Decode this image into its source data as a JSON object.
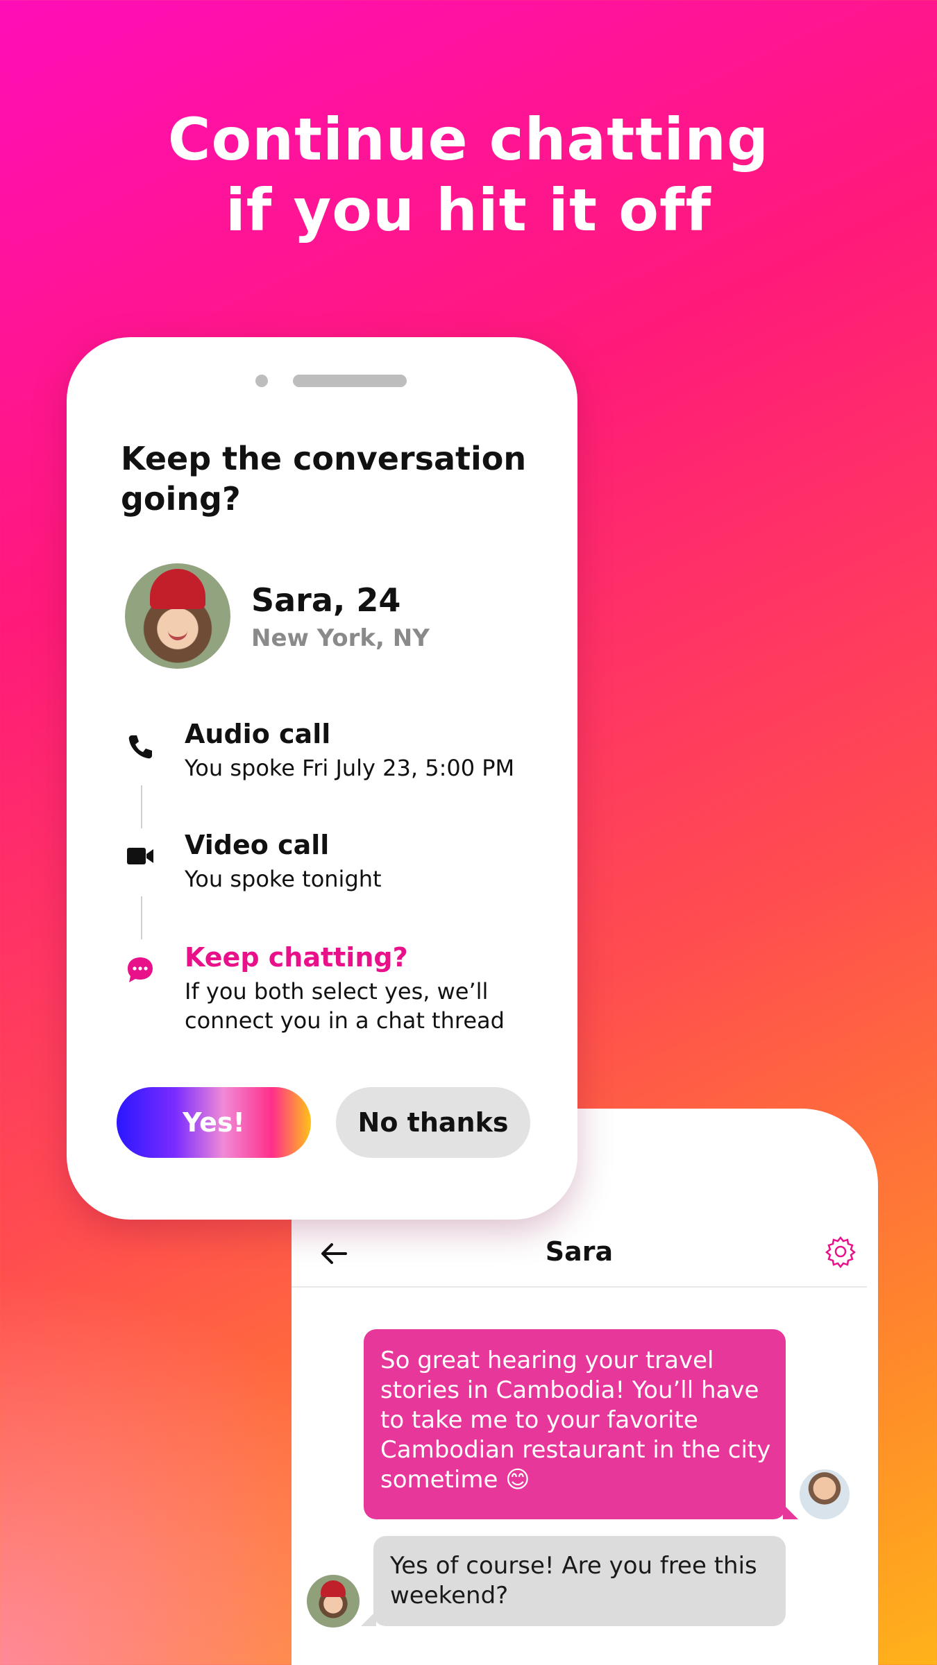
{
  "headline": "Continue chatting\nif you hit it off",
  "modal": {
    "title": "Keep the conversation\ngoing?",
    "profile": {
      "name": "Sara, 24",
      "location": "New York, NY"
    },
    "steps": [
      {
        "icon": "phone-icon",
        "title": "Audio call",
        "desc": "You spoke Fri July 23, 5:00 PM"
      },
      {
        "icon": "video-camera-icon",
        "title": "Video call",
        "desc": "You spoke tonight"
      },
      {
        "icon": "chat-bubble-icon",
        "title": "Keep chatting?",
        "desc": "If you both select yes, we’ll\nconnect you in a chat thread"
      }
    ],
    "yes_label": "Yes!",
    "no_label": "No thanks"
  },
  "chat": {
    "title": "Sara",
    "messages": [
      {
        "from": "me",
        "text": "So great hearing your travel stories in Cambodia! You’ll have to take me to your favorite Cambodian restaurant in the city sometime 😊"
      },
      {
        "from": "Sara",
        "text": "Yes of course! Are you free this weekend?"
      }
    ]
  },
  "colors": {
    "accent_pink": "#e8118a",
    "bubble_out": "#e8379a",
    "bubble_in": "#dcdcdc"
  }
}
